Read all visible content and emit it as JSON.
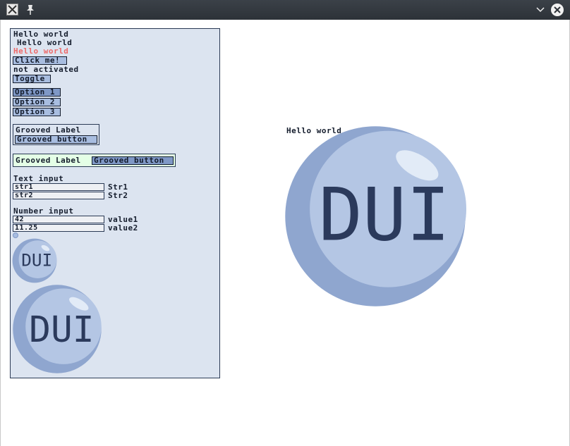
{
  "window": {
    "app_icon": "x-app-icon",
    "pin_icon": "pin-icon",
    "minimize_icon": "chevron-down-icon",
    "close_icon": "close-icon"
  },
  "panel": {
    "hello1": "Hello world",
    "hello2": "Hello world",
    "hello3": "Hello world",
    "click_button": "Click me!",
    "activation_status": "not activated",
    "toggle_button": "Toggle",
    "options": [
      "Option 1",
      "Option 2",
      "Option 3"
    ],
    "grooved_label_1": "Grooved Label",
    "grooved_button_1": "Grooved button",
    "grooved_label_2": "Grooved Label",
    "grooved_button_2": "Grooved button",
    "text_input_heading": "Text input",
    "text_inputs": [
      {
        "value": "str1",
        "label": "Str1"
      },
      {
        "value": "str2",
        "label": "Str2"
      }
    ],
    "number_input_heading": "Number input",
    "number_inputs": [
      {
        "value": "42",
        "label": "value1"
      },
      {
        "value": "11.25",
        "label": "value2"
      }
    ],
    "small_logo_text": "DUI",
    "medium_logo_text": "DUI"
  },
  "main": {
    "hello": "Hello world",
    "logo_text": "DUI"
  },
  "colors": {
    "panel_bg": "#dce4f0",
    "button_bg": "#a8bde0",
    "dark_text": "#141c2c",
    "red_text": "#ee6a6a",
    "green_group": "#e4ffe6",
    "bubble_light": "#a8bde0",
    "bubble_dark": "#2b3a5c"
  }
}
